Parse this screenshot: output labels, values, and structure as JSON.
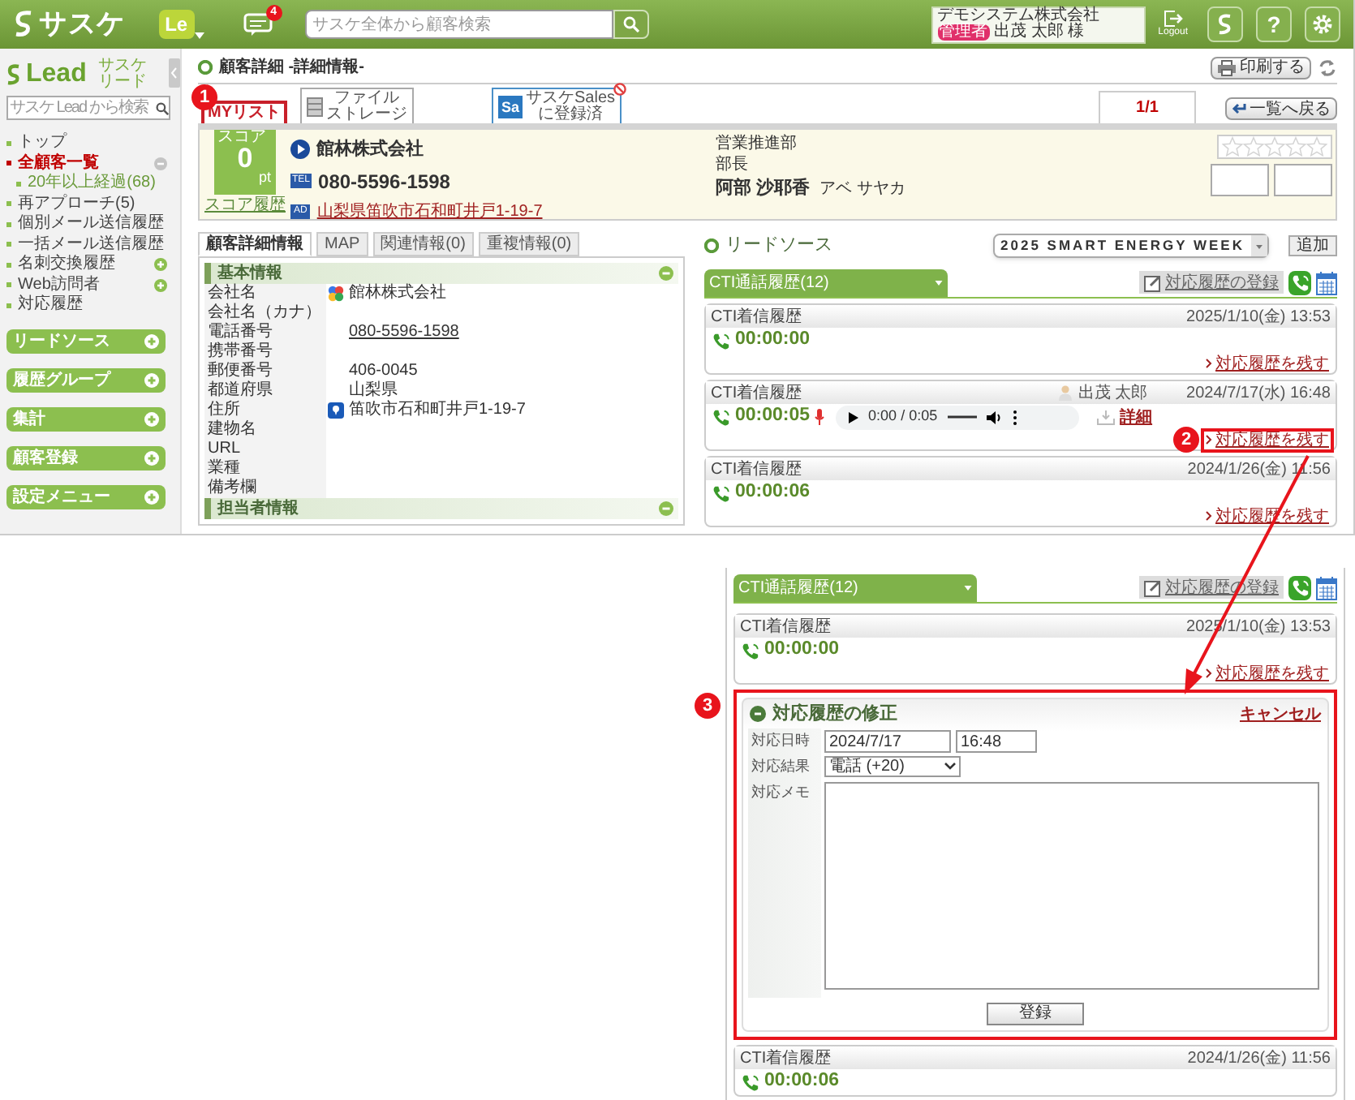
{
  "header": {
    "logo": "サスケ",
    "app_badge": "Le",
    "notification_count": "4",
    "search_placeholder": "サスケ全体から顧客検索",
    "company": "デモシステム株式会社",
    "role_badge": "管理者",
    "user": "出茂 太郎 様",
    "logout": "Logout",
    "help": "?"
  },
  "sidebar": {
    "logo": "Lead",
    "logo_sub": [
      "サスケ",
      "リード"
    ],
    "search_placeholder": "サスケ Lead から検索",
    "items": [
      {
        "label": "トップ",
        "selected": false,
        "kind": "plain"
      },
      {
        "label": "全顧客一覧",
        "selected": true,
        "kind": "open_group",
        "children": [
          {
            "label": "20年以上経過(68)",
            "selected": false
          }
        ]
      },
      {
        "label": "再アプローチ(5)",
        "selected": false,
        "kind": "plain"
      },
      {
        "label": "個別メール送信履歴",
        "selected": false,
        "kind": "plain"
      },
      {
        "label": "一括メール送信履歴",
        "selected": false,
        "kind": "plain"
      },
      {
        "label": "名刺交換履歴",
        "selected": false,
        "kind": "closed_group"
      },
      {
        "label": "Web訪問者",
        "selected": false,
        "kind": "closed_group"
      },
      {
        "label": "対応履歴",
        "selected": false,
        "kind": "plain"
      }
    ],
    "sections": [
      "リードソース",
      "履歴グループ",
      "集計",
      "顧客登録",
      "設定メニュー"
    ]
  },
  "page_title": "顧客詳細 -詳細情報-",
  "print_button": "印刷する",
  "top_tabs": [
    {
      "kind": "mylist",
      "label": "MYリスト",
      "marker": "1"
    },
    {
      "kind": "storage",
      "lines": [
        "ファイル",
        "ストレージ"
      ]
    },
    {
      "kind": "sales",
      "badge": "Sa",
      "lines": [
        "サスケSales",
        "に登録済"
      ]
    }
  ],
  "pager": "1/1",
  "back_button": "一覧へ戻る",
  "customer": {
    "score_label": "スコア",
    "score": "0",
    "score_unit": "pt",
    "score_history": "スコア履歴",
    "company": "館林株式会社",
    "tel_badge": "TEL",
    "phone": "080-5596-1598",
    "address_badge": "AD",
    "address": "山梨県笛吹市石和町井戸1-19-7",
    "department": "営業推進部",
    "title": "部長",
    "name": "阿部 沙耶香",
    "name_kana": "アベ サヤカ",
    "stars": 0
  },
  "detail_tabs": [
    {
      "label": "顧客詳細情報",
      "selected": true
    },
    {
      "label": "MAP",
      "selected": false
    },
    {
      "label": "関連情報(0)",
      "selected": false
    },
    {
      "label": "重複情報(0)",
      "selected": false
    }
  ],
  "basic_info": {
    "title": "基本情報",
    "rows": [
      {
        "kind": "company",
        "label": "会社名",
        "value": "館林株式会社"
      },
      {
        "kind": "plain",
        "label": "会社名（カナ）"
      },
      {
        "kind": "phone",
        "label": "電話番号",
        "value": "080-5596-1598"
      },
      {
        "kind": "plain",
        "label": "携帯番号"
      },
      {
        "kind": "plain",
        "label": "郵便番号",
        "value": "406-0045"
      },
      {
        "kind": "plain",
        "label": "都道府県",
        "value": "山梨県"
      },
      {
        "kind": "address",
        "label": "住所",
        "value": "笛吹市石和町井戸1-19-7"
      },
      {
        "kind": "plain",
        "label": "建物名"
      },
      {
        "kind": "plain",
        "label": "URL"
      },
      {
        "kind": "plain",
        "label": "業種"
      },
      {
        "kind": "plain",
        "label": "備考欄"
      }
    ]
  },
  "contact_info": {
    "title": "担当者情報"
  },
  "lead_source": {
    "title": "リードソース",
    "selected_value": "2025 SMART ENERGY WEEK",
    "add_button": "追加"
  },
  "cti_panel": {
    "tab": "CTI通話履歴(12)",
    "register_button": "対応履歴の登録",
    "entries": [
      {
        "type": "CTI着信履歴",
        "date": "2025/1/10(金) 13:53",
        "duration": "00:00:00",
        "action_link": "対応履歴を残す",
        "highlighted": false
      },
      {
        "type": "CTI着信履歴",
        "agent": "出茂 太郎",
        "date": "2024/7/17(水) 16:48",
        "duration": "00:00:05",
        "player_time": "0:00 / 0:05",
        "detail_link": "詳細",
        "action_link": "対応履歴を残す",
        "highlighted": true,
        "marker": "2"
      },
      {
        "type": "CTI着信履歴",
        "date": "2024/1/26(金) 11:56",
        "duration": "00:00:06",
        "action_link": "対応履歴を残す",
        "highlighted": false
      }
    ]
  },
  "inset": {
    "tab": "CTI通話履歴(12)",
    "register_button": "対応履歴の登録",
    "items": [
      {
        "kind": "entry",
        "type": "CTI着信履歴",
        "date": "2025/1/10(金) 13:53",
        "duration": "00:00:00",
        "action_link": "対応履歴を残す"
      },
      {
        "kind": "form",
        "marker": "3",
        "title": "対応履歴の修正",
        "cancel": "キャンセル",
        "fields": [
          {
            "kind": "datetime",
            "label": "対応日時",
            "date": "2024/7/17",
            "time": "16:48"
          },
          {
            "kind": "select",
            "label": "対応結果",
            "value": "電話 (+20)"
          },
          {
            "kind": "textarea",
            "label": "対応メモ"
          }
        ],
        "submit": "登録"
      },
      {
        "kind": "entry",
        "type": "CTI着信履歴",
        "date": "2024/1/26(金) 11:56",
        "duration": "00:00:06"
      }
    ]
  }
}
